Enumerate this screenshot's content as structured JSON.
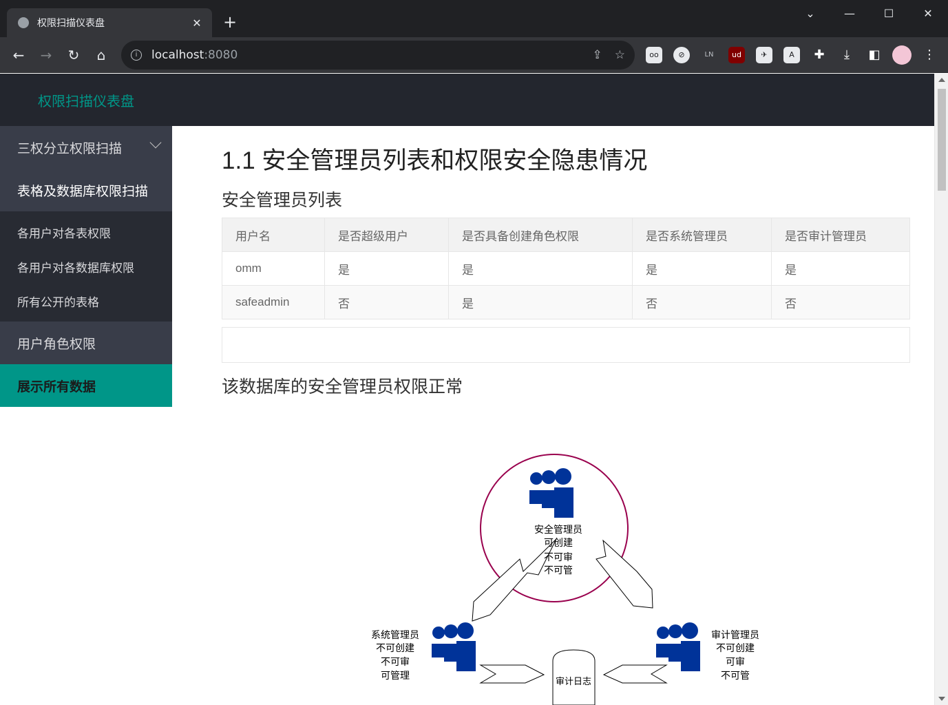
{
  "browser": {
    "tab_title": "权限扫描仪表盘",
    "tab_close": "✕",
    "new_tab": "+",
    "url_host": "localhost",
    "url_port": ":8080",
    "window_controls": {
      "minimize": "—",
      "maximize": "☐",
      "close": "✕"
    },
    "extensions": [
      "LN"
    ]
  },
  "header": {
    "brand": "权限扫描仪表盘"
  },
  "sidebar": {
    "group1": {
      "label": "三权分立权限扫描"
    },
    "group2": {
      "label": "表格及数据库权限扫描",
      "items": [
        "各用户对各表权限",
        "各用户对各数据库权限",
        "所有公开的表格"
      ]
    },
    "group3": {
      "label": "用户角色权限"
    },
    "group4": {
      "label": "展示所有数据"
    }
  },
  "main": {
    "title": "1.1 安全管理员列表和权限安全隐患情况",
    "table_heading": "安全管理员列表",
    "table": {
      "columns": [
        "用户名",
        "是否超级用户",
        "是否具备创建角色权限",
        "是否系统管理员",
        "是否审计管理员"
      ],
      "rows": [
        [
          "omm",
          "是",
          "是",
          "是",
          "是"
        ],
        [
          "safeadmin",
          "否",
          "是",
          "否",
          "否"
        ]
      ]
    },
    "status_heading": "该数据库的安全管理员权限正常"
  },
  "diagram": {
    "security_admin": [
      "安全管理员",
      "可创建",
      "不可审",
      "不可管"
    ],
    "system_admin": [
      "系统管理员",
      "不可创建",
      "不可审",
      "可管理"
    ],
    "audit_admin": [
      "审计管理员",
      "不可创建",
      "可审",
      "不可管"
    ],
    "audit_log": "审计日志",
    "colors": {
      "person": "#003399",
      "circle": "#99004d",
      "accent": "#009688"
    }
  }
}
